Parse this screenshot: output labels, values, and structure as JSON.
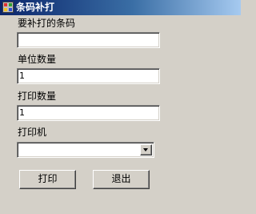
{
  "window": {
    "title": "条码补打",
    "icon": "app-icon"
  },
  "form": {
    "barcode_label": "要补打的条码",
    "barcode_value": "",
    "unit_qty_label": "单位数量",
    "unit_qty_value": "1",
    "print_qty_label": "打印数量",
    "print_qty_value": "1",
    "printer_label": "打印机",
    "printer_value": ""
  },
  "buttons": {
    "print_label": "打印",
    "exit_label": "退出"
  },
  "colors": {
    "face": "#d4d0c8",
    "titlebar_start": "#0a246a",
    "titlebar_end": "#a6caf0"
  }
}
